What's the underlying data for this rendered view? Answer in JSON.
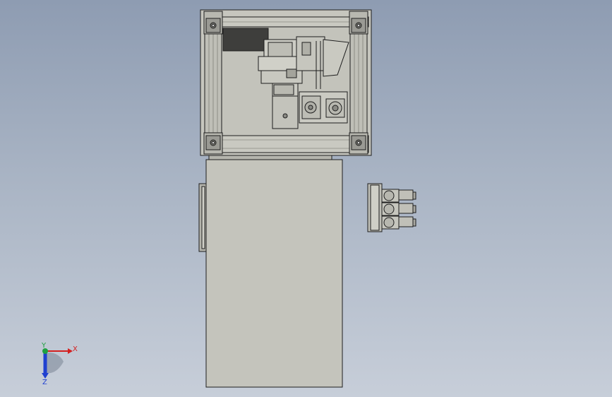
{
  "view": {
    "triad": {
      "x_label": "X",
      "y_label": "Y",
      "z_label": "Z"
    },
    "colors": {
      "background_top": "#8e9cb2",
      "background_bottom": "#c7ced9",
      "frame_metal": "#c3c3bb",
      "cabinet": "#c4c4bc",
      "outline": "#1e1e1e",
      "motor_dark": "#3e3e3c",
      "triad_x": "#d42020",
      "triad_y": "#1fa040",
      "triad_z": "#2040d0"
    }
  }
}
